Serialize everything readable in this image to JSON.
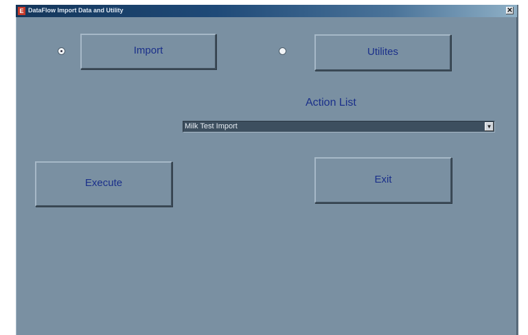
{
  "window": {
    "title": "DataFlow Import Data and Utility",
    "icon": "app-icon",
    "close_glyph": "✕"
  },
  "mode": {
    "import_label": "Import",
    "utilities_label": "Utilites",
    "selected": "import"
  },
  "action_list": {
    "label": "Action List",
    "selected": "Milk Test Import",
    "arrow_glyph": "▼"
  },
  "buttons": {
    "execute_label": "Execute",
    "exit_label": "Exit"
  },
  "colors": {
    "window_bg": "#7a90a2",
    "button_text": "#1a2f8a",
    "titlebar": "#1f4a78"
  }
}
